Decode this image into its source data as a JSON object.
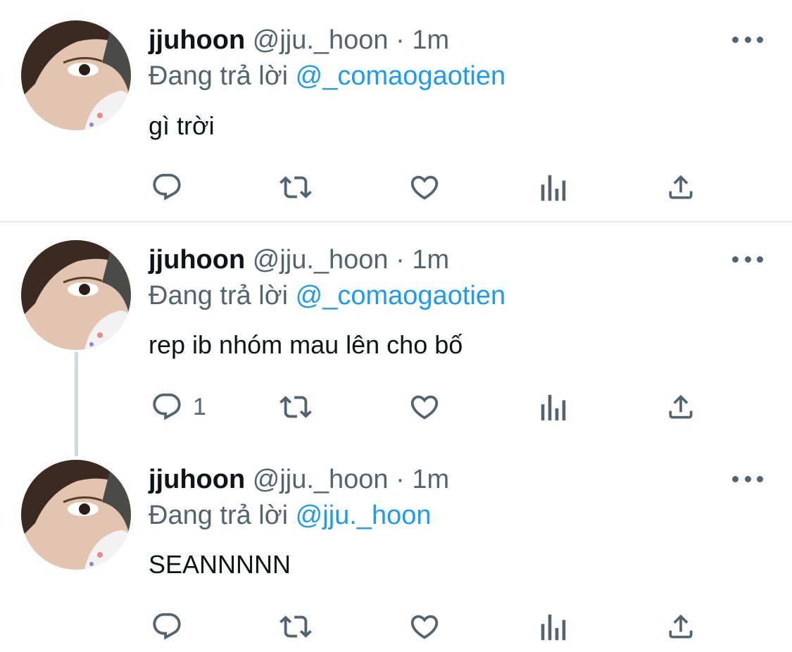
{
  "tweets": [
    {
      "name": "jjuhoon",
      "handle": "@jju._hoon",
      "separator": "·",
      "time": "1m",
      "reply_prefix": "Đang trả lời",
      "reply_to": "@_comaogaotien",
      "text": "gì trời",
      "reply_count": ""
    },
    {
      "name": "jjuhoon",
      "handle": "@jju._hoon",
      "separator": "·",
      "time": "1m",
      "reply_prefix": "Đang trả lời",
      "reply_to": "@_comaogaotien",
      "text": "rep ib nhóm mau lên cho bố",
      "reply_count": "1"
    },
    {
      "name": "jjuhoon",
      "handle": "@jju._hoon",
      "separator": "·",
      "time": "1m",
      "reply_prefix": "Đang trả lời",
      "reply_to": "@jju._hoon",
      "text": "SEANNNNN",
      "reply_count": ""
    }
  ],
  "icons": {
    "reply": "reply-icon",
    "retweet": "retweet-icon",
    "like": "heart-icon",
    "analytics": "analytics-icon",
    "share": "share-icon",
    "more": "more-icon"
  },
  "colors": {
    "mention": "#1d9bf0",
    "secondary_text": "#536471",
    "primary_text": "#0f1419",
    "divider": "#e6ebee",
    "thread_line": "#cfd9de"
  }
}
